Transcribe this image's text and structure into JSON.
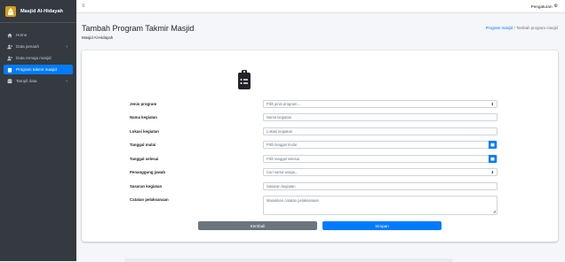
{
  "brand": {
    "name": "Masjid Al-Hidayah"
  },
  "sidebar": {
    "items": [
      {
        "label": "Home",
        "icon": "home-icon"
      },
      {
        "label": "Data jamaah",
        "icon": "user-plus-icon",
        "chevron": "‹"
      },
      {
        "label": "Data remaja masjid",
        "icon": "user-plus-icon"
      },
      {
        "label": "Program takmir masjid",
        "icon": "clipboard-icon"
      },
      {
        "label": "Tampil data",
        "icon": "database-icon",
        "chevron": "‹"
      }
    ]
  },
  "topbar": {
    "menu_icon": "≡",
    "settings_label": "Pengaturan"
  },
  "header": {
    "title": "Tambah Program Takmir Masjid",
    "subtitle": "Masjid Al-Hidayah",
    "breadcrumb_link": "Program masjid",
    "breadcrumb_current": " / Tambah program masjid"
  },
  "form": {
    "jenis_label": "Jenis program",
    "jenis_value": "Pilih jenis program...",
    "nama_label": "Nama kegiatan",
    "nama_placeholder": "Nama kegiatan",
    "lokasi_label": "Lokasi kegiatan",
    "lokasi_placeholder": "Lokasi kegiatan",
    "mulai_label": "Tanggal mulai",
    "mulai_placeholder": "Pilih tanggal mulai",
    "selesai_label": "Tanggal selesai",
    "selesai_placeholder": "Pilih tanggal selesai",
    "pj_label": "Penanggung jawab",
    "pj_value": "Cari nama warga...",
    "sasaran_label": "Sasaran kegiatan",
    "sasaran_placeholder": "Sasaran kegiatan",
    "catatan_label": "Catatan pelaksanaan",
    "catatan_placeholder": "Masukkan catatan pelaksanaan"
  },
  "buttons": {
    "back": "Kembali",
    "save": "Simpan"
  },
  "colors": {
    "primary": "#007bff",
    "sidebar": "#343a40",
    "secondary": "#6c757d"
  }
}
